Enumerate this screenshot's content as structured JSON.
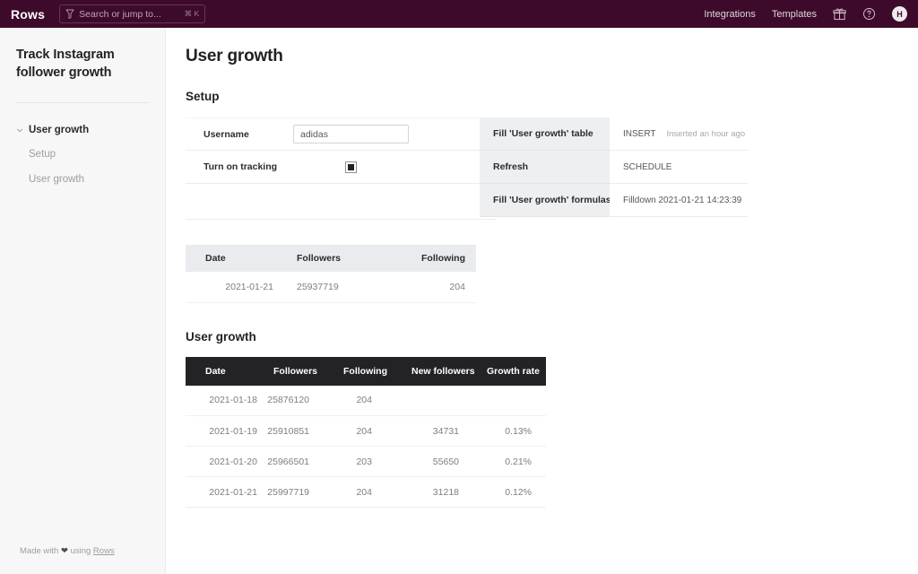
{
  "topbar": {
    "brand": "Rows",
    "search": {
      "placeholder": "Search or jump to...",
      "shortcut": "⌘ K",
      "icon": "search-icon"
    },
    "links": [
      {
        "label": "Integrations"
      },
      {
        "label": "Templates"
      }
    ],
    "gift_icon": "gift-icon",
    "help_icon": "help-circle-icon",
    "avatar_initial": "H"
  },
  "sidebar": {
    "title": "Track Instagram follower growth",
    "group": {
      "label": "User growth",
      "caret": "chevron-down-icon"
    },
    "items": [
      {
        "label": "Setup"
      },
      {
        "label": "User growth"
      }
    ],
    "footer": {
      "prefix": "Made with",
      "heart": "❤",
      "middle": "using",
      "link": "Rows"
    }
  },
  "main": {
    "page_title": "User growth",
    "setup": {
      "heading": "Setup",
      "fields": [
        {
          "label": "Username",
          "value": "adidas",
          "placeholder": "Username"
        },
        {
          "label": "Turn on tracking",
          "checked": true
        }
      ],
      "actions": [
        {
          "name": "Fill 'User growth' table",
          "kind": "INSERT",
          "meta": "Inserted an hour ago"
        },
        {
          "name": "Refresh",
          "kind": "SCHEDULE",
          "meta": ""
        },
        {
          "name": "Fill 'User growth' formulas",
          "kind": "Filldown 2021-01-21 14:23:39",
          "meta": ""
        }
      ]
    },
    "setup_table": {
      "columns": [
        "Date",
        "Followers",
        "Following"
      ],
      "rows": [
        [
          "2021-01-21",
          "25937719",
          "204"
        ]
      ]
    },
    "growth_section": {
      "heading": "User growth",
      "columns": [
        "Date",
        "Followers",
        "Following",
        "New followers",
        "Growth rate"
      ],
      "rows": [
        [
          "2021-01-18",
          "25876120",
          "204",
          "",
          ""
        ],
        [
          "2021-01-19",
          "25910851",
          "204",
          "34731",
          "0.13%"
        ],
        [
          "2021-01-20",
          "25966501",
          "203",
          "55650",
          "0.21%"
        ],
        [
          "2021-01-21",
          "25997719",
          "204",
          "31218",
          "0.12%"
        ]
      ]
    }
  },
  "colors": {
    "topbar_bg": "#3d0a2c",
    "sidebar_bg": "#f7f7f8",
    "table_header_dark": "#232326",
    "table_header_light": "#e9ebee",
    "actions_panel_bg": "#eeeff1"
  }
}
